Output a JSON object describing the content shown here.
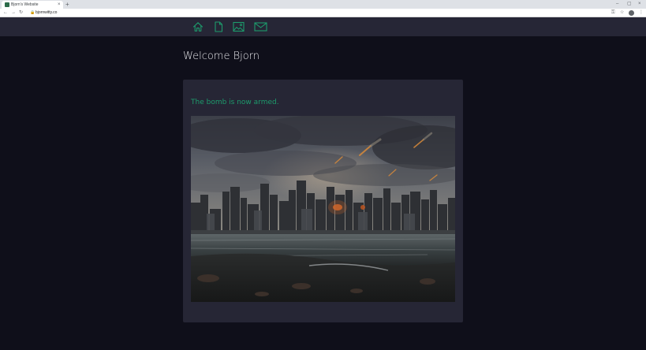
{
  "browser": {
    "tab_title": "Bjorn's Website",
    "tab_close": "×",
    "new_tab": "+",
    "window_controls": {
      "minimize": "–",
      "maximize": "▢",
      "close": "×"
    },
    "nav": {
      "back": "←",
      "forward": "→",
      "reload": "↻"
    },
    "url_lock": "🔒",
    "url": "bjornwitty.co",
    "right_icons": {
      "key": "⚿",
      "star": "☆",
      "menu": "⋮"
    }
  },
  "sitenav": {
    "icons": [
      "home-icon",
      "document-icon",
      "image-icon",
      "mail-icon"
    ],
    "icon_color": "#1d9b6c"
  },
  "main": {
    "welcome": "Welcome Bjorn",
    "message": "The bomb is now armed.",
    "message_color": "#1d9b6c"
  },
  "colors": {
    "page_bg": "#0f0f1a",
    "nav_bg": "#262636",
    "card_bg": "#262635"
  }
}
